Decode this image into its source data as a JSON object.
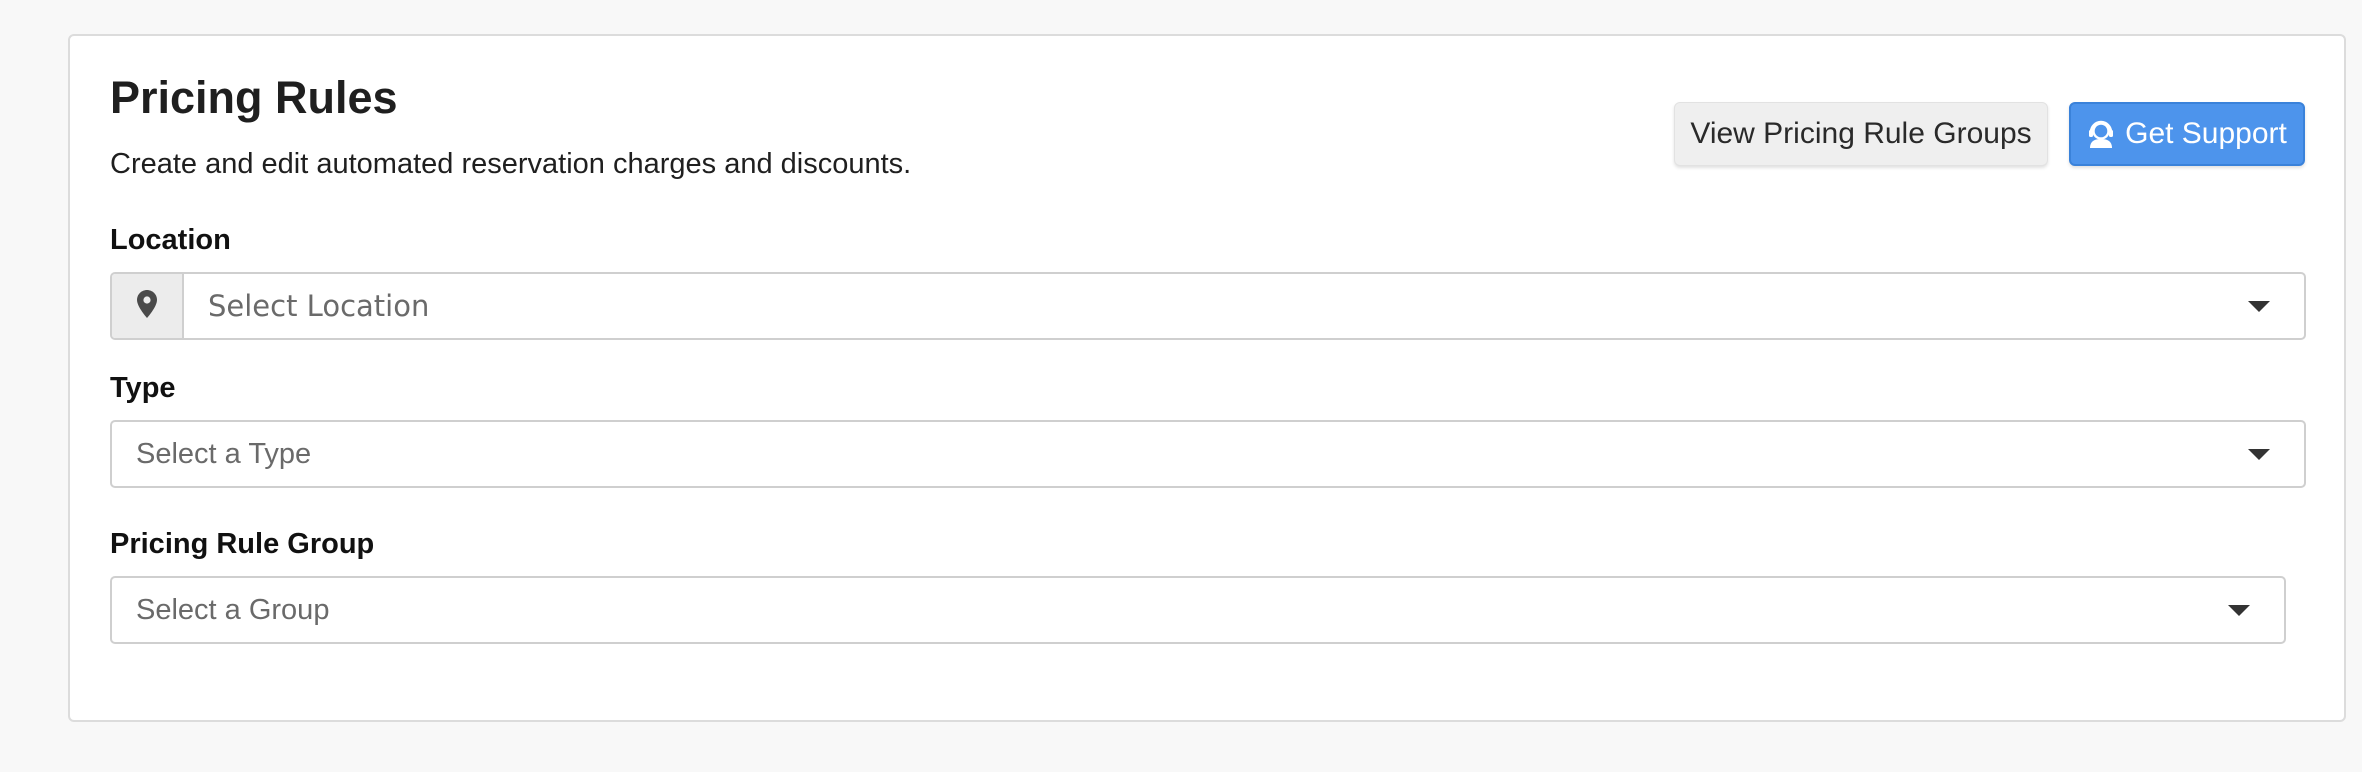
{
  "header": {
    "title": "Pricing Rules",
    "subtitle": "Create and edit automated reservation charges and discounts."
  },
  "actions": {
    "view_groups_label": "View Pricing Rule Groups",
    "support_label": "Get Support",
    "support_icon": "support-agent-icon",
    "support_color": "#4d94ec"
  },
  "fields": {
    "location": {
      "label": "Location",
      "placeholder": "Select Location",
      "icon": "map-pin-icon"
    },
    "type": {
      "label": "Type",
      "placeholder": "Select a Type"
    },
    "group": {
      "label": "Pricing Rule Group",
      "placeholder": "Select a Group"
    }
  }
}
